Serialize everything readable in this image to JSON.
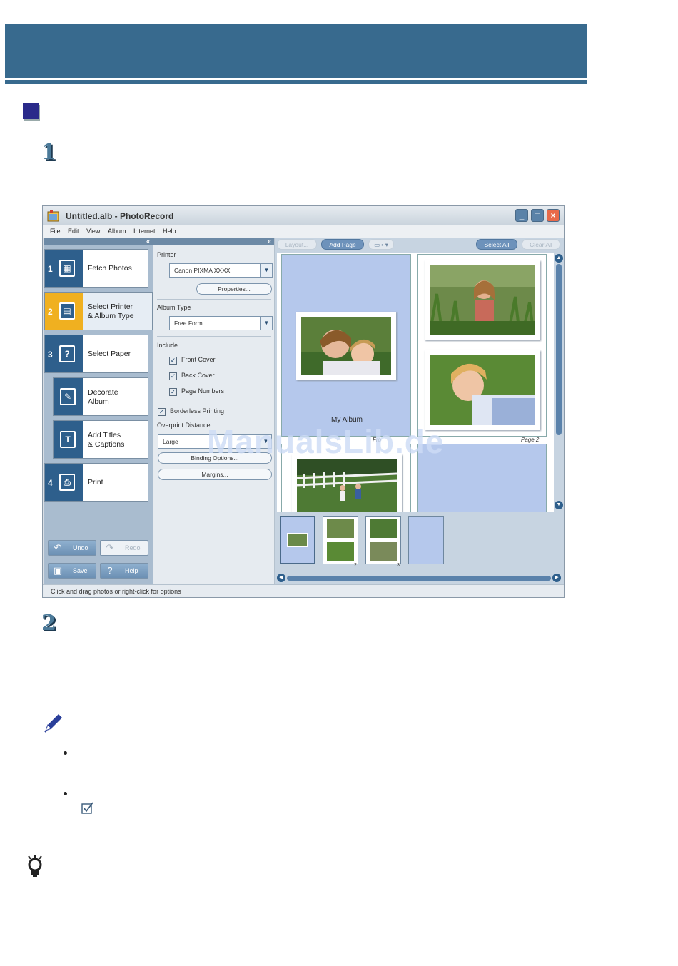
{
  "document": {
    "step_1_number": "1",
    "step_2_number": "2"
  },
  "window": {
    "title": "Untitled.alb - PhotoRecord",
    "min_label": "_",
    "max_label": "□",
    "close_label": "×"
  },
  "menu": [
    "File",
    "Edit",
    "View",
    "Album",
    "Internet",
    "Help"
  ],
  "left_panel": {
    "collapse": "«",
    "steps": [
      {
        "num": "1",
        "label": "Fetch Photos"
      },
      {
        "num": "2",
        "label": "Select Printer\n& Album Type"
      },
      {
        "num": "3",
        "label": "Select Paper"
      },
      {
        "num": "",
        "label": "Decorate\nAlbum"
      },
      {
        "num": "",
        "label": "Add Titles\n& Captions"
      },
      {
        "num": "4",
        "label": "Print"
      }
    ],
    "undo": "Undo",
    "redo": "Redo",
    "save": "Save",
    "help": "Help"
  },
  "settings": {
    "collapse": "«",
    "printer_label": "Printer",
    "printer_value": "Canon PIXMA XXXX",
    "properties_button": "Properties...",
    "album_type_label": "Album Type",
    "album_type_value": "Free Form",
    "include_label": "Include",
    "front_cover": "Front Cover",
    "back_cover": "Back Cover",
    "page_numbers": "Page Numbers",
    "borderless_printing": "Borderless Printing",
    "overprint_label": "Overprint Distance",
    "overprint_value": "Large",
    "binding_button": "Binding Options...",
    "margins_button": "Margins..."
  },
  "toolbar": {
    "layout": "Layout...",
    "add_page": "Add Page",
    "view_toggle": "▭ ▪ ▾",
    "select_all": "Select All",
    "clear_all": "Clear All"
  },
  "canvas": {
    "cover_title": "My Album",
    "front_label": "Fro",
    "page_label": "Page 2"
  },
  "thumbnails": {
    "page_2": "2",
    "page_3": "3"
  },
  "status": "Click and drag photos or right-click for options",
  "watermark": "ManualsLib.de"
}
